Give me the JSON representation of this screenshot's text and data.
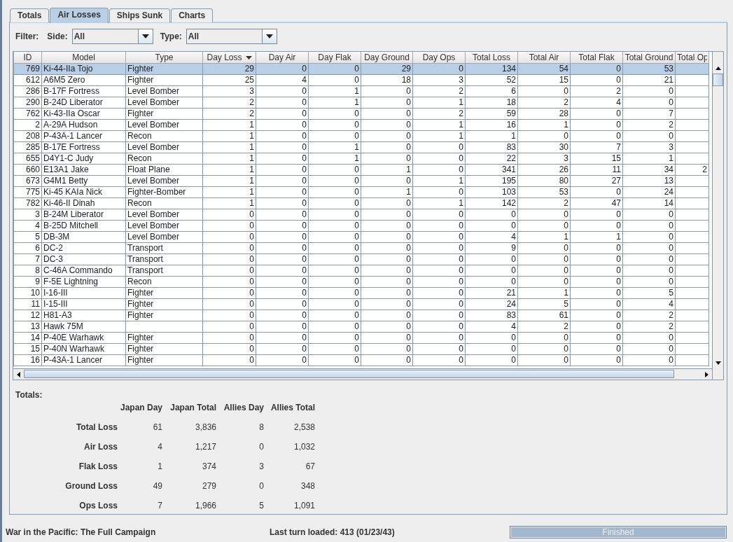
{
  "tabs": [
    {
      "label": "Totals",
      "selected": false
    },
    {
      "label": "Air Losses",
      "selected": true
    },
    {
      "label": "Ships Sunk",
      "selected": false
    },
    {
      "label": "Charts",
      "selected": false
    }
  ],
  "filter": {
    "label": "Filter:",
    "side": {
      "label": "Side:",
      "value": "All"
    },
    "type": {
      "label": "Type:",
      "value": "All"
    }
  },
  "table": {
    "columns": [
      {
        "label": "ID",
        "sorted": false
      },
      {
        "label": "Model",
        "sorted": false
      },
      {
        "label": "Type",
        "sorted": false
      },
      {
        "label": "Day Loss",
        "sorted": true
      },
      {
        "label": "Day Air",
        "sorted": false
      },
      {
        "label": "Day Flak",
        "sorted": false
      },
      {
        "label": "Day Ground",
        "sorted": false
      },
      {
        "label": "Day Ops",
        "sorted": false
      },
      {
        "label": "Total Loss",
        "sorted": false
      },
      {
        "label": "Total Air",
        "sorted": false
      },
      {
        "label": "Total Flak",
        "sorted": false
      },
      {
        "label": "Total Ground",
        "sorted": false
      },
      {
        "label": "Total Op",
        "sorted": false
      }
    ],
    "rows": [
      {
        "id": "769",
        "model": "Ki-44-IIa Tojo",
        "type": "Fighter",
        "values": [
          "29",
          "0",
          "0",
          "29",
          "0",
          "134",
          "54",
          "0",
          "53"
        ],
        "selected": true
      },
      {
        "id": "612",
        "model": "A6M5 Zero",
        "type": "Fighter",
        "values": [
          "25",
          "4",
          "0",
          "18",
          "3",
          "52",
          "15",
          "0",
          "21"
        ],
        "selected": false
      },
      {
        "id": "286",
        "model": "B-17F Fortress",
        "type": "Level Bomber",
        "values": [
          "3",
          "0",
          "1",
          "0",
          "2",
          "6",
          "0",
          "2",
          "0"
        ],
        "selected": false
      },
      {
        "id": "290",
        "model": "B-24D Liberator",
        "type": "Level Bomber",
        "values": [
          "2",
          "0",
          "1",
          "0",
          "1",
          "18",
          "2",
          "4",
          "0"
        ],
        "selected": false
      },
      {
        "id": "762",
        "model": "Ki-43-IIa Oscar",
        "type": "Fighter",
        "values": [
          "2",
          "0",
          "0",
          "0",
          "2",
          "59",
          "28",
          "0",
          "7"
        ],
        "selected": false
      },
      {
        "id": "2",
        "model": "A-29A Hudson",
        "type": "Level Bomber",
        "values": [
          "1",
          "0",
          "0",
          "0",
          "1",
          "16",
          "1",
          "0",
          "2"
        ],
        "selected": false
      },
      {
        "id": "208",
        "model": "P-43A-1 Lancer",
        "type": "Recon",
        "values": [
          "1",
          "0",
          "0",
          "0",
          "1",
          "1",
          "0",
          "0",
          "0"
        ],
        "selected": false
      },
      {
        "id": "285",
        "model": "B-17E Fortress",
        "type": "Level Bomber",
        "values": [
          "1",
          "0",
          "1",
          "0",
          "0",
          "83",
          "30",
          "7",
          "3"
        ],
        "selected": false
      },
      {
        "id": "655",
        "model": "D4Y1-C Judy",
        "type": "Recon",
        "values": [
          "1",
          "0",
          "1",
          "0",
          "0",
          "22",
          "3",
          "15",
          "1"
        ],
        "selected": false
      },
      {
        "id": "660",
        "model": "E13A1 Jake",
        "type": "Float Plane",
        "values": [
          "1",
          "0",
          "0",
          "1",
          "0",
          "341",
          "26",
          "11",
          "34"
        ],
        "total_op": "2",
        "selected": false
      },
      {
        "id": "673",
        "model": "G4M1 Betty",
        "type": "Level Bomber",
        "values": [
          "1",
          "0",
          "0",
          "0",
          "1",
          "195",
          "80",
          "27",
          "13"
        ],
        "selected": false
      },
      {
        "id": "775",
        "model": "Ki-45 KAIa Nick",
        "type": "Fighter-Bomber",
        "values": [
          "1",
          "0",
          "0",
          "1",
          "0",
          "103",
          "53",
          "0",
          "24"
        ],
        "selected": false
      },
      {
        "id": "782",
        "model": "Ki-46-II Dinah",
        "type": "Recon",
        "values": [
          "1",
          "0",
          "0",
          "0",
          "1",
          "142",
          "2",
          "47",
          "14"
        ],
        "selected": false
      },
      {
        "id": "3",
        "model": "B-24M Liberator",
        "type": "Level Bomber",
        "values": [
          "0",
          "0",
          "0",
          "0",
          "0",
          "0",
          "0",
          "0",
          "0"
        ],
        "selected": false
      },
      {
        "id": "4",
        "model": "B-25D Mitchell",
        "type": "Level Bomber",
        "values": [
          "0",
          "0",
          "0",
          "0",
          "0",
          "0",
          "0",
          "0",
          "0"
        ],
        "selected": false
      },
      {
        "id": "5",
        "model": "DB-3M",
        "type": "Level Bomber",
        "values": [
          "0",
          "0",
          "0",
          "0",
          "0",
          "4",
          "1",
          "1",
          "0"
        ],
        "selected": false
      },
      {
        "id": "6",
        "model": "DC-2",
        "type": "Transport",
        "values": [
          "0",
          "0",
          "0",
          "0",
          "0",
          "9",
          "0",
          "0",
          "0"
        ],
        "selected": false
      },
      {
        "id": "7",
        "model": "DC-3",
        "type": "Transport",
        "values": [
          "0",
          "0",
          "0",
          "0",
          "0",
          "0",
          "0",
          "0",
          "0"
        ],
        "selected": false
      },
      {
        "id": "8",
        "model": "C-46A Commando",
        "type": "Transport",
        "values": [
          "0",
          "0",
          "0",
          "0",
          "0",
          "0",
          "0",
          "0",
          "0"
        ],
        "selected": false
      },
      {
        "id": "9",
        "model": "F-5E Lightning",
        "type": "Recon",
        "values": [
          "0",
          "0",
          "0",
          "0",
          "0",
          "0",
          "0",
          "0",
          "0"
        ],
        "selected": false
      },
      {
        "id": "10",
        "model": "I-16-III",
        "type": "Fighter",
        "values": [
          "0",
          "0",
          "0",
          "0",
          "0",
          "21",
          "1",
          "0",
          "5"
        ],
        "selected": false
      },
      {
        "id": "11",
        "model": "I-15-III",
        "type": "Fighter",
        "values": [
          "0",
          "0",
          "0",
          "0",
          "0",
          "24",
          "5",
          "0",
          "4"
        ],
        "selected": false
      },
      {
        "id": "12",
        "model": "H81-A3",
        "type": "Fighter",
        "values": [
          "0",
          "0",
          "0",
          "0",
          "0",
          "83",
          "61",
          "0",
          "2"
        ],
        "selected": false
      },
      {
        "id": "13",
        "model": "Hawk 75M",
        "values": [
          "0",
          "0",
          "0",
          "0",
          "0",
          "4",
          "2",
          "0",
          "2"
        ],
        "selected": false
      },
      {
        "id": "14",
        "model": "P-40E Warhawk",
        "type": "Fighter",
        "values": [
          "0",
          "0",
          "0",
          "0",
          "0",
          "0",
          "0",
          "0",
          "0"
        ],
        "selected": false
      },
      {
        "id": "15",
        "model": "P-40N Warhawk",
        "type": "Fighter",
        "values": [
          "0",
          "0",
          "0",
          "0",
          "0",
          "0",
          "0",
          "0",
          "0"
        ],
        "selected": false
      },
      {
        "id": "16",
        "model": "P-43A-1 Lancer",
        "type": "Fighter",
        "values": [
          "0",
          "0",
          "0",
          "0",
          "0",
          "0",
          "0",
          "0",
          "0"
        ],
        "selected": false
      }
    ]
  },
  "totals": {
    "title": "Totals:",
    "columns": [
      "Japan Day",
      "Japan Total",
      "Allies Day",
      "Allies Total"
    ],
    "rows": [
      {
        "label": "Total Loss",
        "values": [
          "61",
          "3,836",
          "8",
          "2,538"
        ]
      },
      {
        "label": "Air Loss",
        "values": [
          "4",
          "1,217",
          "0",
          "1,032"
        ]
      },
      {
        "label": "Flak Loss",
        "values": [
          "1",
          "374",
          "3",
          "67"
        ]
      },
      {
        "label": "Ground Loss",
        "values": [
          "49",
          "279",
          "0",
          "348"
        ]
      },
      {
        "label": "Ops Loss",
        "values": [
          "7",
          "1,966",
          "5",
          "1,091"
        ]
      }
    ]
  },
  "status_bar": {
    "title": "War in the Pacific: The Full Campaign",
    "turn": "Last turn loaded: 413 (01/23/43)",
    "progress": {
      "label": "Finished",
      "level": 1
    }
  }
}
